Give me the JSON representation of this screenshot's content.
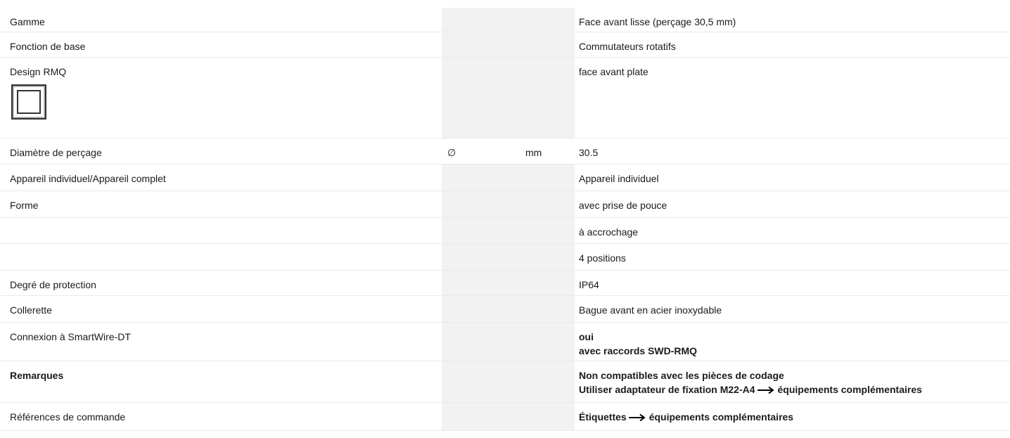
{
  "page_title": "",
  "rows": [
    {
      "label": "Gamme",
      "symbol": "",
      "unit": "",
      "value": "Face avant lisse (perçage 30,5 mm)"
    },
    {
      "label": "Fonction de base",
      "symbol": "",
      "unit": "",
      "value": "Commutateurs rotatifs"
    },
    {
      "label": "Design RMQ",
      "symbol": "",
      "unit": "",
      "value": "face avant plate",
      "icon": "flat-front-square-icon"
    },
    {
      "label": "Diamètre de perçage",
      "symbol": "∅",
      "unit": "mm",
      "value": "30.5"
    },
    {
      "label": "Appareil individuel/Appareil complet",
      "symbol": "",
      "unit": "",
      "value": "Appareil individuel"
    },
    {
      "label": "Forme",
      "symbol": "",
      "unit": "",
      "value": "avec prise de pouce"
    },
    {
      "label": "",
      "symbol": "",
      "unit": "",
      "value": "à accrochage"
    },
    {
      "label": "",
      "symbol": "",
      "unit": "",
      "value": "4 positions"
    },
    {
      "label": "Degré de protection",
      "symbol": "",
      "unit": "",
      "value": "IP64"
    },
    {
      "label": "Collerette",
      "symbol": "",
      "unit": "",
      "value": "Bague avant en acier inoxydable"
    },
    {
      "label": "Connexion à SmartWire-DT",
      "symbol": "",
      "unit": "",
      "value_lines": [
        "oui",
        "avec raccords SWD-RMQ"
      ]
    },
    {
      "label": "Remarques",
      "symbol": "",
      "unit": "",
      "value_lines": [
        "Non compatibles avec les pièces de codage",
        "Utiliser adaptateur de fixation M22-A4",
        "équipements complémentaires"
      ]
    },
    {
      "label": "Références de commande",
      "symbol": "",
      "unit": "",
      "value_parts": [
        "Étiquettes",
        "équipements complémentaires"
      ]
    }
  ],
  "colors": {
    "accent": "#3d7ac9",
    "shaded_column": "#f2f2f2",
    "row_divider": "#eaeaea"
  },
  "icons": [
    "flat-front-square-icon",
    "arrow-right-icon"
  ]
}
